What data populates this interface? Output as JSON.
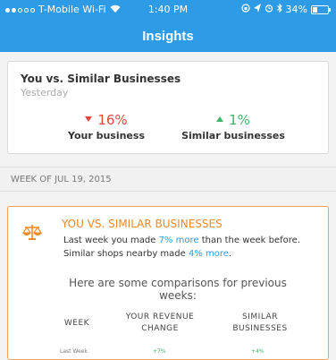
{
  "status_bar": {
    "carrier": "T-Mobile Wi-Fi",
    "time": "1:40 PM",
    "battery": "34%",
    "battery_level": 0.34
  },
  "header": {
    "title": "Insights"
  },
  "comparison_card": {
    "title": "You vs. Similar Businesses",
    "subtitle": "Yesterday",
    "your_business": {
      "value": "16%",
      "direction": "down",
      "label": "Your business",
      "color": "#e8453c"
    },
    "similar_businesses": {
      "value": "1%",
      "direction": "up",
      "label": "Similar businesses",
      "color": "#3fb36b"
    }
  },
  "week_section": {
    "label": "WEEK OF JUL 19, 2015"
  },
  "insight_card": {
    "title": "YOU VS. SIMILAR BUSINESSES",
    "text_1": "Last week you made ",
    "highlight_1": "7% more",
    "text_2": " than the week before. Similar shops nearby made ",
    "highlight_2": "4% more",
    "text_3": ".",
    "comparison_text": "Here are some comparisons for previous weeks:",
    "table_headers": {
      "week": "WEEK",
      "revenue": "YOUR REVENUE CHANGE",
      "similar": "SIMILAR BUSINESSES"
    },
    "rows": [
      {
        "week": "Last Week",
        "revenue": "+7%",
        "similar": "+4%"
      }
    ],
    "accent_color": "#f08a2a",
    "highlight_color": "#2e9be6"
  }
}
